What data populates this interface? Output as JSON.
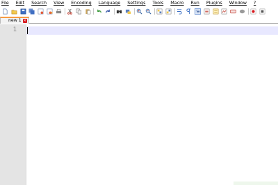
{
  "menu": {
    "items": [
      {
        "label": "File"
      },
      {
        "label": "Edit"
      },
      {
        "label": "Search"
      },
      {
        "label": "View"
      },
      {
        "label": "Encoding"
      },
      {
        "label": "Language"
      },
      {
        "label": "Settings"
      },
      {
        "label": "Tools"
      },
      {
        "label": "Macro"
      },
      {
        "label": "Run"
      },
      {
        "label": "Plugins"
      },
      {
        "label": "Window"
      },
      {
        "label": "?"
      }
    ]
  },
  "toolbar": {
    "icons": [
      "new-file-icon",
      "open-folder-icon",
      "save-icon",
      "save-all-icon",
      "close-icon",
      "close-all-icon",
      "print-icon",
      "cut-icon",
      "copy-icon",
      "paste-icon",
      "undo-icon",
      "redo-icon",
      "find-icon",
      "replace-icon",
      "zoom-in-icon",
      "zoom-out-icon",
      "sync-vertical-icon",
      "sync-horizontal-icon",
      "word-wrap-icon",
      "show-all-characters-icon",
      "indent-guide-icon",
      "function-list-icon",
      "folder-as-workspace-icon",
      "document-map-icon",
      "monitoring-icon",
      "record-macro-icon",
      "stop-macro-icon",
      "play-macro-icon"
    ]
  },
  "tabs": [
    {
      "label": "new 1",
      "close_glyph": "✕",
      "active": true
    }
  ],
  "editor": {
    "line_numbers": [
      "1"
    ],
    "content": ""
  },
  "colors": {
    "gutter": "#e4e4e4",
    "current_line": "#e8e8ff",
    "tab_accent": "#f79b43",
    "tab_close": "#d6171d"
  }
}
